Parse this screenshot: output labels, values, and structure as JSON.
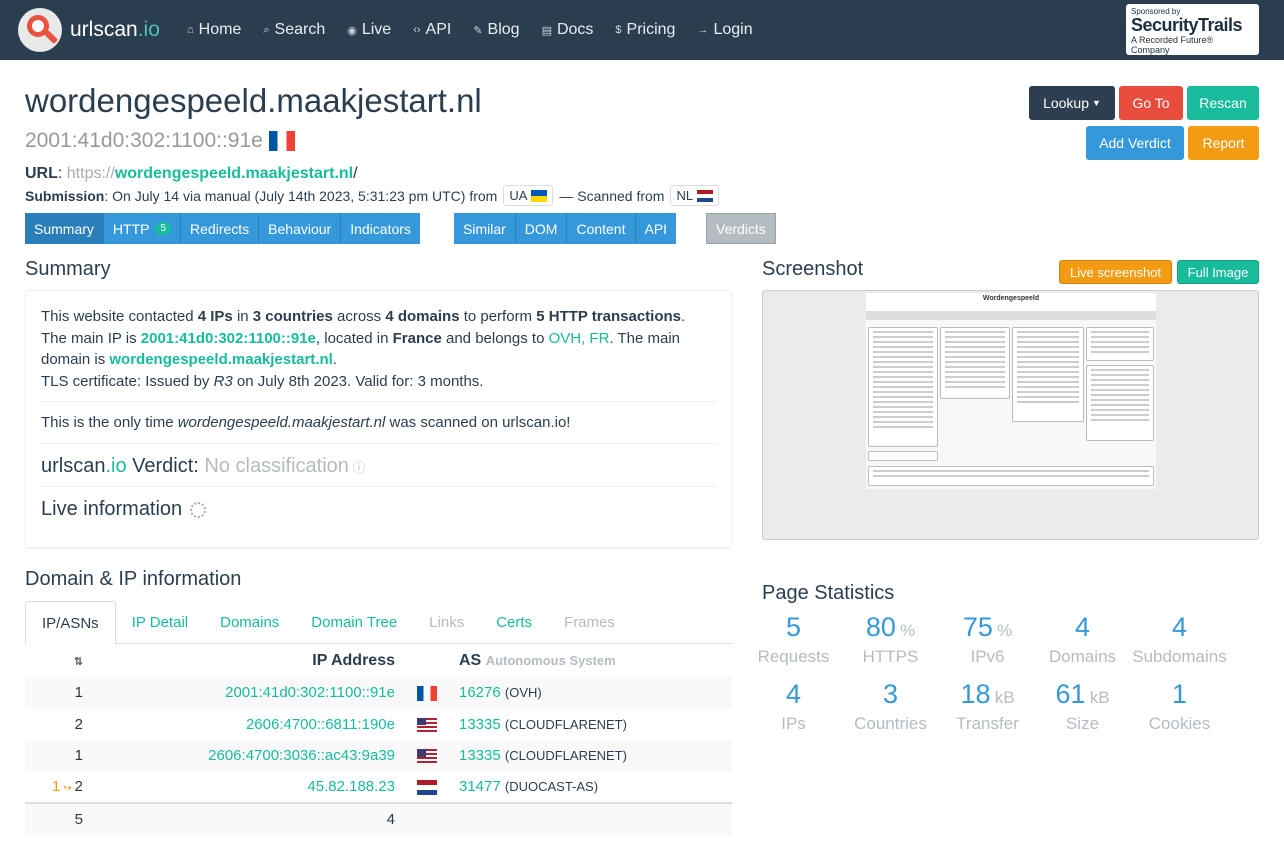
{
  "nav": {
    "brand": "urlscan",
    "brand_io": ".io",
    "items": [
      "Home",
      "Search",
      "Live",
      "API",
      "Blog",
      "Docs",
      "Pricing",
      "Login"
    ],
    "sponsor_line1": "Sponsored by",
    "sponsor_line2": "SecurityTrails",
    "sponsor_line3": "A Recorded Future® Company"
  },
  "page": {
    "title": "wordengespeeld.maakjestart.nl",
    "ip": "2001:41d0:302:1100::91e",
    "ip_country": "FR",
    "url_label": "URL",
    "url_scheme": "https://",
    "url_host": "wordengespeeld.maakjestart.nl",
    "url_path": "/",
    "submission_label": "Submission",
    "submission_text": ": On July 14 via manual (July 14th 2023, 5:31:23 pm UTC) from",
    "from_country": "UA",
    "scanned_text": "— Scanned from",
    "scanned_country": "NL"
  },
  "actions": {
    "lookup": "Lookup",
    "goto": "Go To",
    "rescan": "Rescan",
    "add_verdict": "Add Verdict",
    "report": "Report"
  },
  "tabs1": [
    {
      "label": "Summary"
    },
    {
      "label": "HTTP",
      "badge": "5"
    },
    {
      "label": "Redirects"
    },
    {
      "label": "Behaviour"
    },
    {
      "label": "Indicators"
    }
  ],
  "tabs2": [
    "Similar",
    "DOM",
    "Content",
    "API"
  ],
  "tabs3": "Verdicts",
  "summary": {
    "heading": "Summary",
    "s1": "This website contacted ",
    "ips": "4 IPs",
    "s2": " in ",
    "countries": "3 countries",
    "s3": " across ",
    "domains": "4 domains",
    "s4": " to perform ",
    "transactions": "5 HTTP transactions",
    "s5": ".",
    "s6": "The main IP is ",
    "main_ip": "2001:41d0:302:1100::91e",
    "s7": ", located in ",
    "country": "France",
    "s8": " and belongs to ",
    "asn_link": "OVH, FR",
    "s9": ". The main domain is ",
    "main_domain": "wordengespeeld.maakjestart.nl",
    "s10": ".",
    "tls1": "TLS certificate: Issued by ",
    "issuer": "R3",
    "tls2": " on July 8th 2023. Valid for: 3 months.",
    "only1": "This is the only time ",
    "only_domain": "wordengespeeld.maakjestart.nl",
    "only2": " was scanned on urlscan.io!",
    "verdict_brand": "urlscan",
    "verdict_io": ".io",
    "verdict_label": " Verdict: ",
    "verdict_value": "No classification",
    "live_label": "Live information"
  },
  "screenshot": {
    "heading": "Screenshot",
    "live_btn": "Live screenshot",
    "full_btn": "Full Image",
    "mock_title": "Wordengespeeld"
  },
  "domain_ip": {
    "heading": "Domain & IP information",
    "tabs": [
      {
        "label": "IP/ASNs",
        "state": "active"
      },
      {
        "label": "IP Detail",
        "state": "link"
      },
      {
        "label": "Domains",
        "state": "link"
      },
      {
        "label": "Domain Tree",
        "state": "link"
      },
      {
        "label": "Links",
        "state": "disabled"
      },
      {
        "label": "Certs",
        "state": "link"
      },
      {
        "label": "Frames",
        "state": "disabled"
      }
    ],
    "col_ip": "IP Address",
    "col_as": "AS",
    "col_as_sub": "Autonomous System",
    "rows": [
      {
        "count": "1",
        "ip": "2001:41d0:302:1100::91e",
        "flag": "fr",
        "asn": "16276",
        "asname": "(OVH)"
      },
      {
        "count": "2",
        "ip": "2606:4700::6811:190e",
        "flag": "us",
        "asn": "13335",
        "asname": "(CLOUDFLARENET)"
      },
      {
        "count": "1",
        "ip": "2606:4700:3036::ac43:9a39",
        "flag": "us",
        "asn": "13335",
        "asname": "(CLOUDFLARENET)"
      },
      {
        "count": "2",
        "prefix": "1",
        "ip": "45.82.188.23",
        "flag": "nl",
        "asn": "31477",
        "asname": "(DUOCAST-AS)"
      }
    ],
    "total_count": "5",
    "total_ips": "4"
  },
  "stats": {
    "heading": "Page Statistics",
    "items": [
      {
        "num": "5",
        "unit": "",
        "label": "Requests"
      },
      {
        "num": "80",
        "unit": "%",
        "label": "HTTPS"
      },
      {
        "num": "75",
        "unit": "%",
        "label": "IPv6"
      },
      {
        "num": "4",
        "unit": "",
        "label": "Domains"
      },
      {
        "num": "4",
        "unit": "",
        "label": "Subdomains"
      },
      {
        "num": "4",
        "unit": "",
        "label": "IPs"
      },
      {
        "num": "3",
        "unit": "",
        "label": "Countries"
      },
      {
        "num": "18",
        "unit": "kB",
        "label": "Transfer"
      },
      {
        "num": "61",
        "unit": "kB",
        "label": "Size"
      },
      {
        "num": "1",
        "unit": "",
        "label": "Cookies"
      }
    ]
  },
  "colors": {
    "navbar": "#2b3e50",
    "accent": "#18bc9c",
    "link_blue": "#3498db",
    "orange": "#f39c12",
    "red": "#e74c3c"
  }
}
